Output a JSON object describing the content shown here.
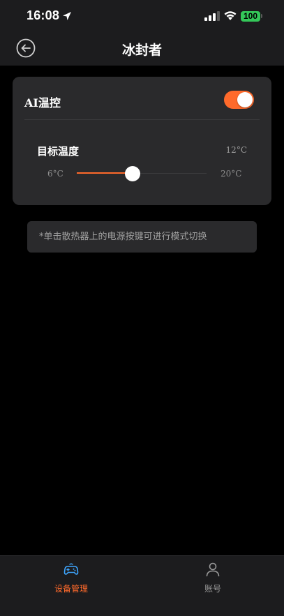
{
  "status_bar": {
    "time": "16:08",
    "battery": "100",
    "icons": [
      "location-arrow-icon",
      "cellular-signal-icon",
      "wifi-icon",
      "battery-icon"
    ]
  },
  "nav": {
    "title": "冰封者",
    "back_icon": "back-arrow-circle-icon"
  },
  "card": {
    "ai_label": "AI温控",
    "ai_enabled": true,
    "target_label": "目标温度",
    "target_value": "12°C",
    "slider": {
      "min_label": "6°C",
      "max_label": "20°C",
      "min": 6,
      "max": 20,
      "value": 12
    }
  },
  "hint": "*单击散热器上的电源按键可进行模式切换",
  "tabs": [
    {
      "label": "设备管理",
      "icon": "gamepad-icon",
      "active": true
    },
    {
      "label": "账号",
      "icon": "person-icon",
      "active": false
    }
  ],
  "colors": {
    "accent": "#ff6a2b",
    "background": "#000000",
    "surface": "#2a2a2c",
    "bar": "#1c1c1e",
    "battery": "#34c759",
    "tab_active_icon": "#3ea6ff"
  }
}
